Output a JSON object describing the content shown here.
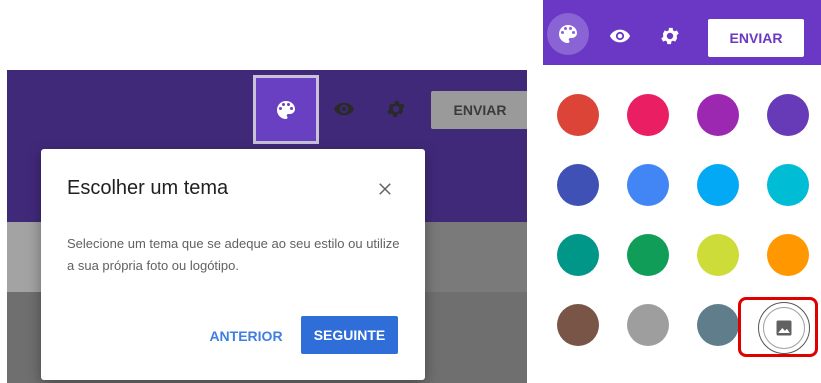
{
  "left_toolbar": {
    "send_label": "ENVIAR",
    "icons": [
      "palette-icon",
      "eye-icon",
      "gear-icon"
    ]
  },
  "dialog": {
    "title": "Escolher um tema",
    "body": "Selecione um tema que se adeque ao seu estilo ou utilize a sua própria foto ou logótipo.",
    "prev_label": "ANTERIOR",
    "next_label": "SEGUINTE",
    "close_icon": "close-icon"
  },
  "right_toolbar": {
    "send_label": "ENVIAR",
    "icons": [
      "palette-icon",
      "eye-icon",
      "gear-icon"
    ]
  },
  "theme_colors": [
    [
      "#db4437",
      "#e91e63",
      "#9c27b0",
      "#673ab7"
    ],
    [
      "#3f51b5",
      "#4285f4",
      "#03a9f4",
      "#00bcd4"
    ],
    [
      "#009688",
      "#0f9d58",
      "#cddc39",
      "#ff9800"
    ],
    [
      "#795548",
      "#9e9e9e",
      "#607d8b"
    ]
  ],
  "custom_image_icon": "image-icon",
  "colors": {
    "header_purple": "#6a38c4",
    "dim_header": "#41297a",
    "accent_blue": "#2f6ed8",
    "highlight_red": "#e00000"
  }
}
